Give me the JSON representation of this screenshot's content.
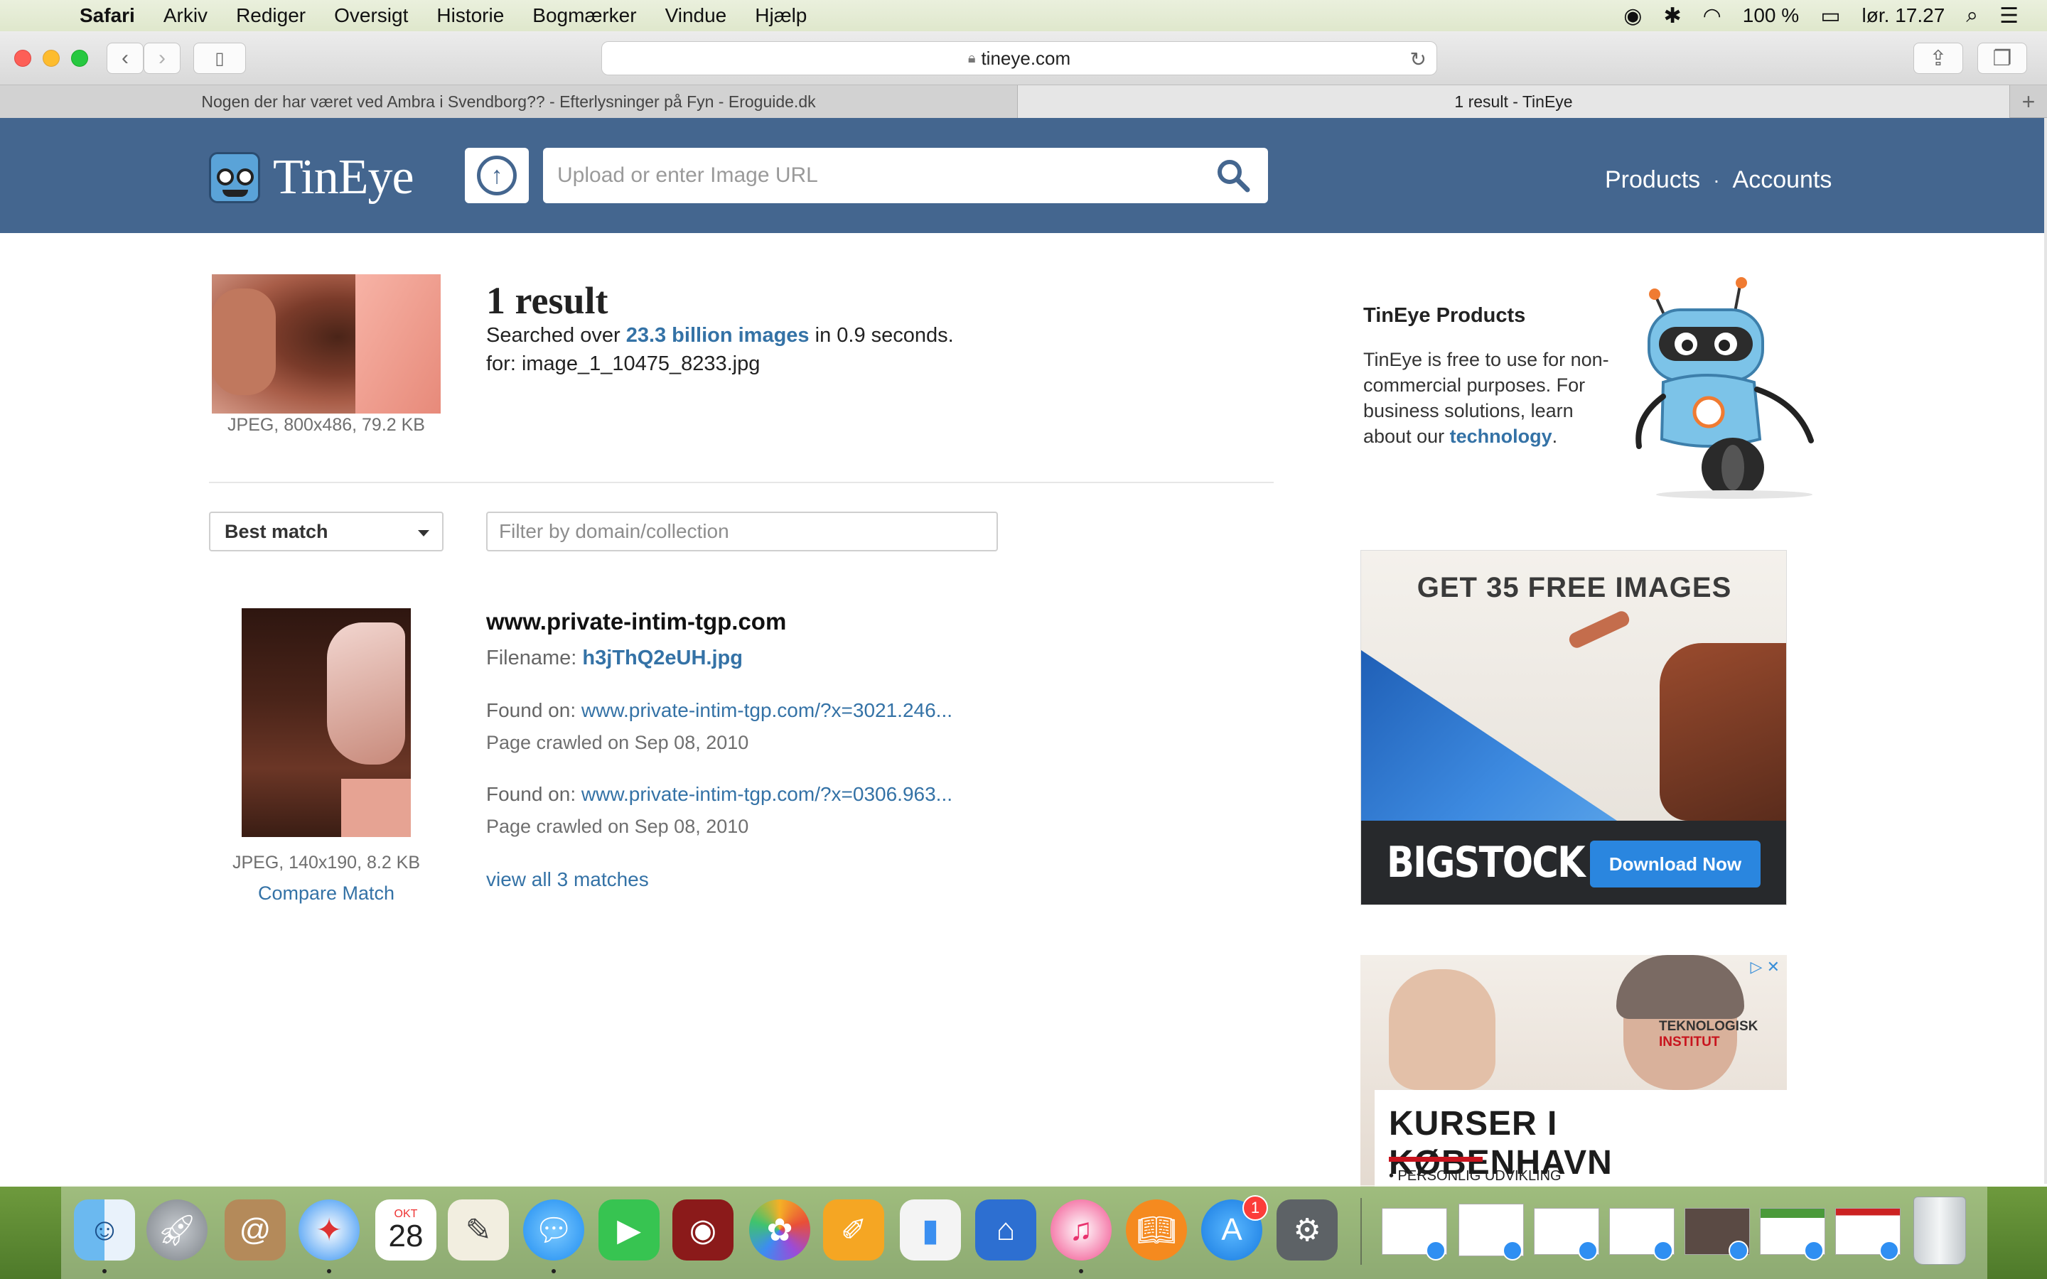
{
  "menubar": {
    "app": "Safari",
    "items": [
      "Arkiv",
      "Rediger",
      "Oversigt",
      "Historie",
      "Bogmærker",
      "Vindue",
      "Hjælp"
    ],
    "battery": "100 %",
    "clock": "lør. 17.27"
  },
  "browser": {
    "url": "tineye.com",
    "tabs": [
      {
        "title": "Nogen der har været ved Ambra i Svendborg?? - Efterlysninger på Fyn - Eroguide.dk",
        "active": false
      },
      {
        "title": "1 result - TinEye",
        "active": true
      }
    ],
    "new_tab": "+"
  },
  "header": {
    "logo_text": "TinEye",
    "search_placeholder": "Upload or enter Image URL",
    "nav": [
      "Products",
      "Accounts"
    ],
    "nav_sep": "·"
  },
  "summary": {
    "result_count": "1 result",
    "searched_prefix": "Searched over",
    "searched_link": "23.3 billion images",
    "searched_suffix": "in 0.9 seconds.",
    "for_line": "for: image_1_10475_8233.jpg",
    "query_meta": "JPEG, 800x486, 79.2 KB"
  },
  "controls": {
    "sort_label": "Best match",
    "filter_placeholder": "Filter by domain/collection"
  },
  "match": {
    "domain": "www.private-intim-tgp.com",
    "filename_label": "Filename:",
    "filename": "h3jThQ2eUH.jpg",
    "found": [
      {
        "label": "Found on:",
        "url": "www.private-intim-tgp.com/?x=3021.246...",
        "crawled": "Page crawled on Sep 08, 2010"
      },
      {
        "label": "Found on:",
        "url": "www.private-intim-tgp.com/?x=0306.963...",
        "crawled": "Page crawled on Sep 08, 2010"
      }
    ],
    "view_all": "view all 3 matches",
    "thumb_meta": "JPEG, 140x190, 8.2 KB",
    "compare": "Compare Match"
  },
  "sidebar": {
    "title": "TinEye Products",
    "text": "TinEye is free to use for non-commercial purposes. For business solutions, learn about our",
    "link": "technology",
    "text_end": "."
  },
  "ad1": {
    "headline": "GET 35 FREE IMAGES",
    "brand": "BIGSTOCK",
    "button": "Download Now"
  },
  "ad2": {
    "institute_line1": "TEKNOLOGISK",
    "institute_line2": "INSTITUT",
    "title": "KURSER I KØBENHAVN",
    "bullet": "• PERSONLIG UDVIKLING"
  },
  "dock": {
    "calendar_month": "OKT",
    "calendar_day": "28",
    "appstore_badge": "1"
  },
  "colors": {
    "header_bg": "#44668f",
    "link": "#3472a6",
    "ad_button": "#2a86df"
  }
}
